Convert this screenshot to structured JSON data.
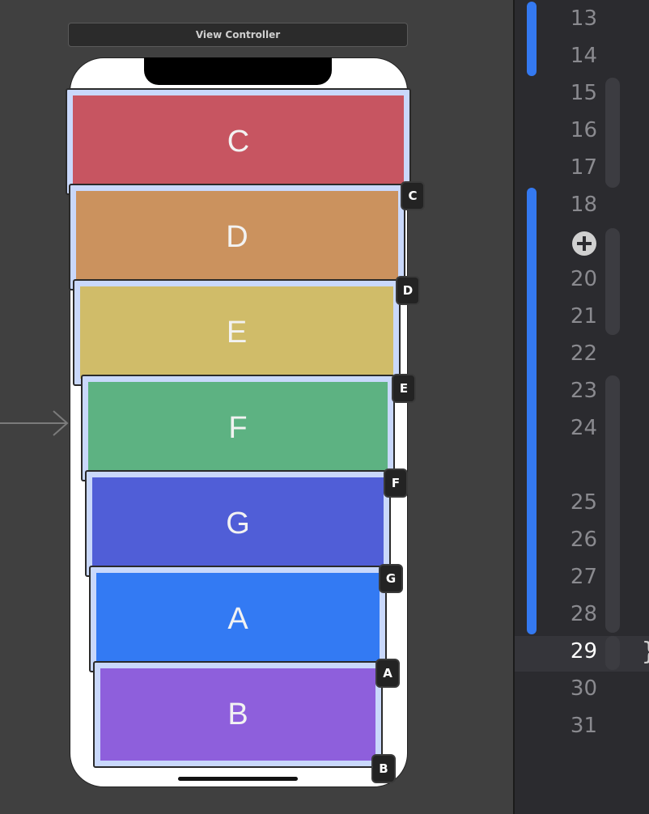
{
  "scene": {
    "title": "View Controller"
  },
  "cells": [
    {
      "label": "C",
      "badge": "C",
      "color": "#c75561"
    },
    {
      "label": "D",
      "badge": "C",
      "color": "#cb925e"
    },
    {
      "label": "E",
      "badge": "D",
      "color": "#d0bc69"
    },
    {
      "label": "F",
      "badge": "E",
      "color": "#5db282"
    },
    {
      "label": "G",
      "badge": "F",
      "color": "#505ed7"
    },
    {
      "label": "A",
      "badge": "G",
      "color": "#337af3"
    },
    {
      "label": "B",
      "badge": "A",
      "color": "#8e5fdc"
    }
  ],
  "last_badge": "B",
  "editor": {
    "line_numbers": [
      "13",
      "14",
      "15",
      "16",
      "17",
      "18",
      "20",
      "21",
      "22",
      "23",
      "24",
      "25",
      "26",
      "27",
      "28",
      "29",
      "30",
      "31"
    ],
    "current_line": "29",
    "gutter_icon": "add-breakpoint-icon",
    "trailing_text": "}"
  }
}
